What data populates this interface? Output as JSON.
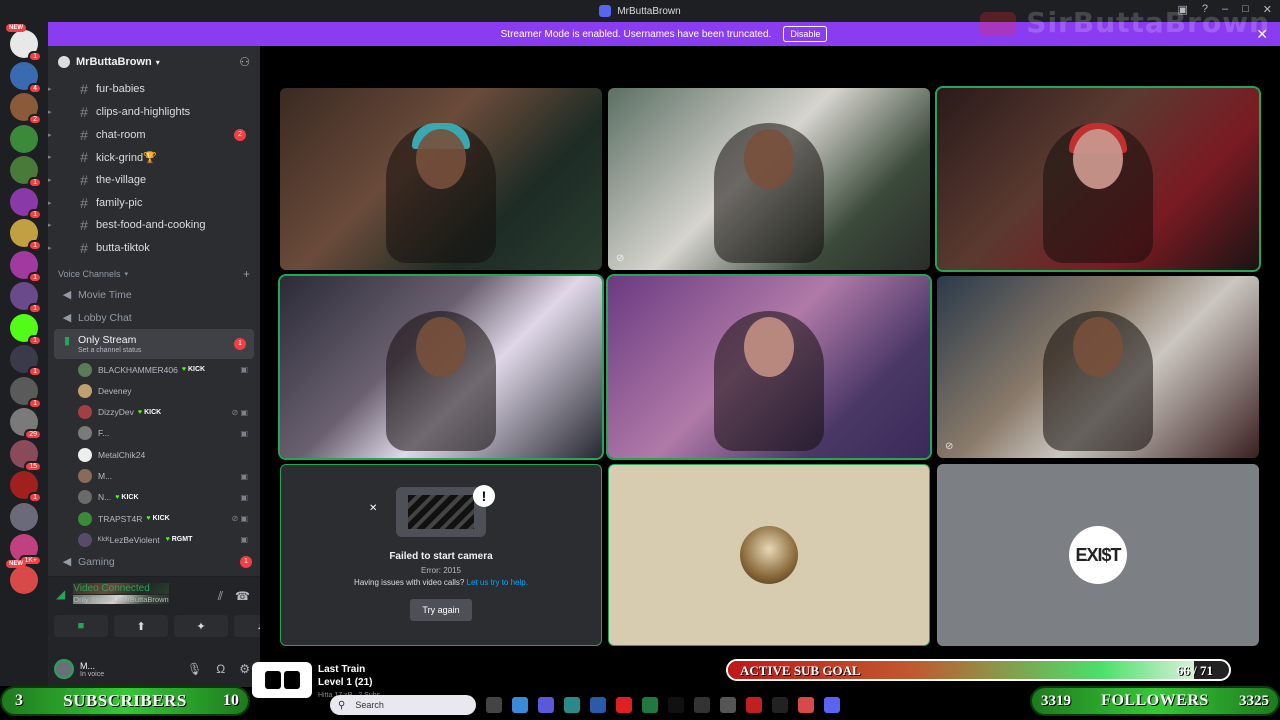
{
  "window": {
    "title": "MrButtaBrown",
    "watermark": "SirButtaBrown"
  },
  "banner": {
    "text": "Streamer Mode is enabled. Usernames have been truncated.",
    "button": "Disable"
  },
  "rail": {
    "servers": [
      {
        "tag": "NEW",
        "badge": "1",
        "color": "#e8e8e8"
      },
      {
        "badge": "4",
        "color": "#3a6ab0"
      },
      {
        "badge": "2",
        "color": "#8a5a3a"
      },
      {
        "badge": "",
        "color": "#3a8a3a"
      },
      {
        "badge": "1",
        "color": "#4a7a3a"
      },
      {
        "badge": "1",
        "color": "#8a3aa8"
      },
      {
        "badge": "1",
        "color": "#c0a040"
      },
      {
        "badge": "1",
        "color": "#a03aa0"
      },
      {
        "badge": "1",
        "color": "#6a4a8a"
      },
      {
        "badge": "1",
        "color": "#53fc18"
      },
      {
        "badge": "1",
        "color": "#3a3a4a"
      },
      {
        "badge": "1",
        "color": "#5a5a5a"
      },
      {
        "badge": "29",
        "color": "#7a7a7a"
      },
      {
        "badge": "15",
        "color": "#8a4a5a"
      },
      {
        "badge": "1",
        "color": "#a02020"
      },
      {
        "badge": "",
        "color": "#6a6a7a"
      },
      {
        "badge": "1K+",
        "color": "#c04080"
      },
      {
        "tag": "NEW",
        "badge": "",
        "color": "#d84a4a"
      }
    ]
  },
  "sidebar": {
    "guild": "MrButtaBrown",
    "text_channels": [
      {
        "name": "fur-babies",
        "mention": ""
      },
      {
        "name": "clips-and-highlights",
        "mention": ""
      },
      {
        "name": "chat-room",
        "mention": "2"
      },
      {
        "name": "kick-grind🏆",
        "mention": ""
      },
      {
        "name": "the-village",
        "mention": ""
      },
      {
        "name": "family-pic",
        "mention": ""
      },
      {
        "name": "best-food-and-cooking",
        "mention": ""
      },
      {
        "name": "butta-tiktok",
        "mention": ""
      }
    ],
    "voice_category": "Voice Channels",
    "voice_channels_top": [
      {
        "name": "Movie Time"
      },
      {
        "name": "Lobby Chat"
      }
    ],
    "active_voice": {
      "name": "Only Stream",
      "status": "Set a channel status",
      "mention": "1"
    },
    "voice_users": [
      {
        "name": "BLACKHAMMER406",
        "kick": "KICK",
        "icons": "▣",
        "color": "#5a7a5a"
      },
      {
        "name": "Deveney",
        "kick": "",
        "icons": "",
        "color": "#c0a070"
      },
      {
        "name": "DizzyDev",
        "kick": "KICK",
        "icons": "⊘ ▣",
        "color": "#a04040"
      },
      {
        "name": "F...",
        "kick": "",
        "icons": "▣",
        "color": "#7a7a7a"
      },
      {
        "name": "MetalChik24",
        "kick": "",
        "icons": "",
        "color": "#eeeeee"
      },
      {
        "name": "M...",
        "kick": "",
        "icons": "▣",
        "color": "#8a6a5a"
      },
      {
        "name": "N...",
        "kick": "KICK",
        "icons": "▣",
        "color": "#6a6a6a"
      },
      {
        "name": "TRAPST4R",
        "kick": "KICK",
        "icons": "⊘ ▣",
        "color": "#3a8a3a"
      },
      {
        "name": "ᴷᴵᶜᴷLezBeViolent",
        "kick": "",
        "extra": "RGMT",
        "icons": "▣",
        "color": "#5a4a6a"
      }
    ],
    "voice_after": {
      "name": "Gaming",
      "mention": "1"
    }
  },
  "voice_panel": {
    "status": "Video Connected",
    "channel": "Only Stream / MrButtaBrown",
    "user_name": "M...",
    "user_status": "In voice"
  },
  "camera_error": {
    "title": "Failed to start camera",
    "error": "Error: 2015",
    "help_prefix": "Having issues with video calls?",
    "help_link": "Let us try to help.",
    "retry": "Try again"
  },
  "exist_avatar": "EXI$T",
  "overlay": {
    "track_title": "Last Train",
    "track_level": "Level 1 (21)",
    "track_sub": "Hitta 17 xP · 2 Subs",
    "goal_label": "ACTIVE SUB GOAL",
    "goal_value": "66 / 71",
    "goal_progress": 0.93,
    "subs_current": "3",
    "subs_label": "SUBSCRIBERS",
    "subs_target": "10",
    "followers_current": "3319",
    "followers_label": "FOLLOWERS",
    "followers_target": "3325",
    "search_placeholder": "Search"
  },
  "colors": {
    "accent": "#5865f2",
    "success": "#23a55a",
    "danger": "#f23f43",
    "banner": "#8a3df0"
  }
}
